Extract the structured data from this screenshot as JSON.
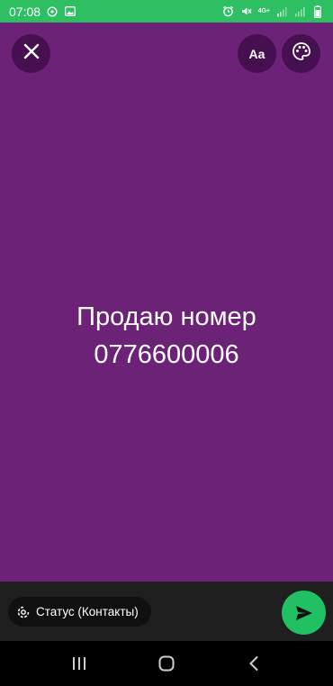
{
  "status_bar": {
    "time": "07:08",
    "network": "4G+",
    "background_color": "#2fbf63"
  },
  "editor": {
    "background_color": "#6b2277",
    "text_lines": [
      "Продаю номер",
      "0776600006"
    ],
    "font_button_label": "Aa",
    "close_icon": "close-icon",
    "palette_icon": "palette-icon"
  },
  "bottom_bar": {
    "audience_label": "Статус (Контакты)",
    "audience_icon": "status-ring-icon",
    "send_icon": "send-icon",
    "send_color": "#21c063"
  },
  "nav_bar": {
    "icons": [
      "recent-apps-icon",
      "home-icon",
      "back-icon"
    ]
  }
}
